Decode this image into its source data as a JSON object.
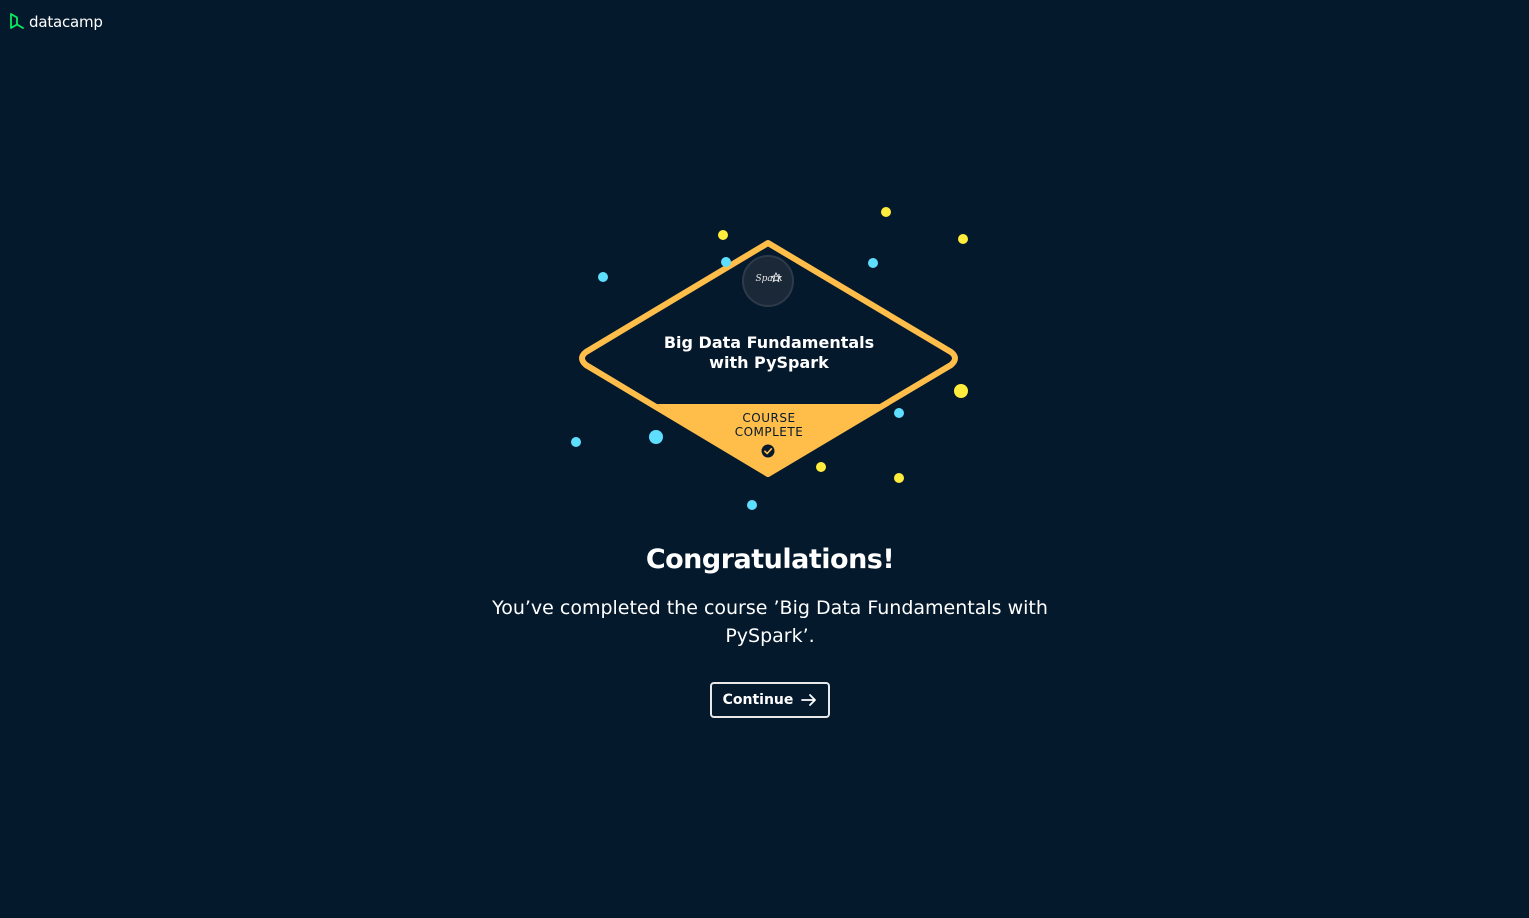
{
  "brand": {
    "name": "datacamp",
    "accent_color": "#03ef62"
  },
  "badge": {
    "logo_text": "Spark",
    "title_line1": "Big Data Fundamentals",
    "title_line2": "with PySpark",
    "status_line1": "COURSE",
    "status_line2": "COMPLETE",
    "status_icon": "check-circle-icon",
    "frame_color": "#ffbd4a",
    "confetti_colors": [
      "#ffec3d",
      "#5fdfff"
    ]
  },
  "main": {
    "heading": "Congratulations!",
    "message": "You’ve completed the course ’Big Data Fundamentals with PySpark’.",
    "continue_label": "Continue",
    "continue_icon": "arrow-right-icon"
  },
  "colors": {
    "background": "#05192d",
    "text": "#ffffff"
  }
}
